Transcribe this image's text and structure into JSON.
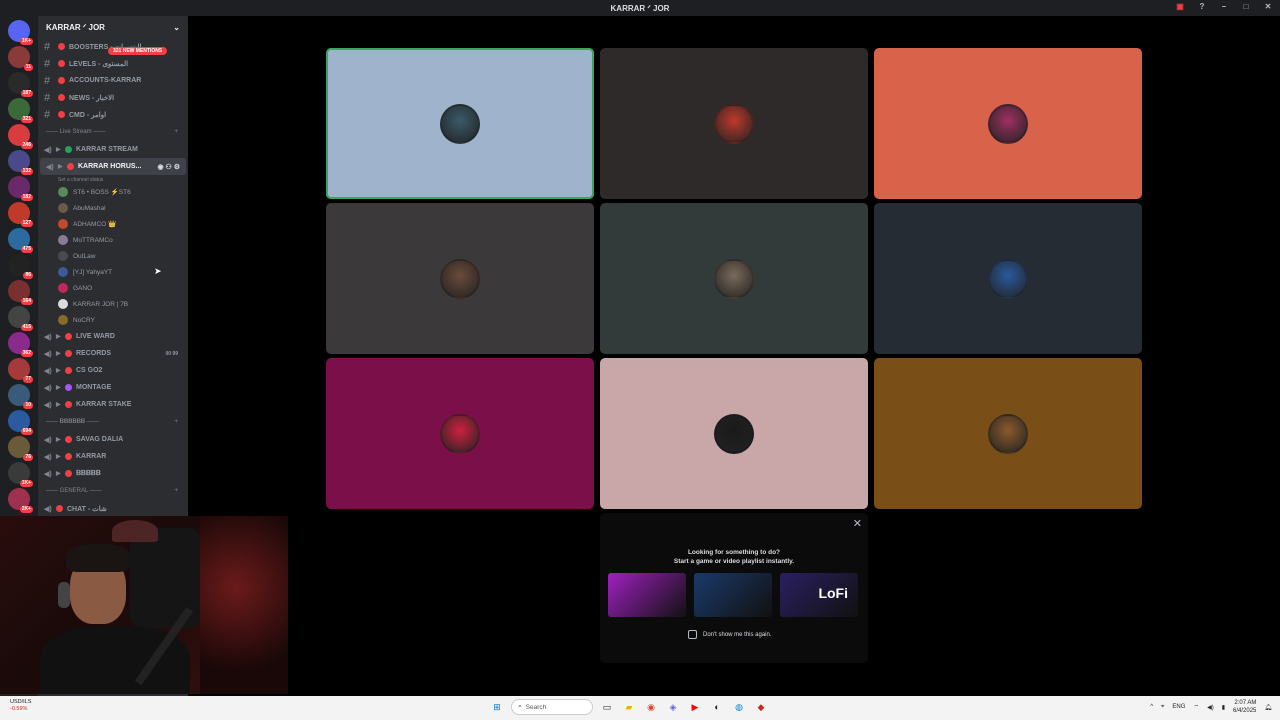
{
  "window": {
    "title": "KARRAR ᐟ JOR",
    "controls": [
      "inbox-icon",
      "help-icon",
      "minimize-icon",
      "maximize-icon",
      "close-icon"
    ]
  },
  "server_badges": [
    "1K+",
    "11",
    "187",
    "321",
    "246",
    "132",
    "182",
    "127",
    "475",
    "86",
    "164",
    "415",
    "362",
    "77",
    "10",
    "694",
    "76",
    "1K+",
    "2K+"
  ],
  "server_colors": [
    "#5865f2",
    "#8b3a3a",
    "#2a2a2a",
    "#3a6a3a",
    "#d83c3e",
    "#4a4a8a",
    "#6a2a6a",
    "#c0392b",
    "#2d6aa0",
    "#222",
    "#7a3030",
    "#444",
    "#8a2a8a",
    "#a63a3a",
    "#3a5a7a",
    "#2a5aa0",
    "#6a5a3a",
    "#3a3a3a",
    "#a03050"
  ],
  "guild": {
    "name": "KARRAR ᐟ JOR",
    "mention_pill": "321 NEW MENTIONS",
    "text_channels": [
      {
        "label": "BOOSTERS - البنسرات",
        "dot": "#f23f43"
      },
      {
        "label": "LEVELS - المستوى",
        "dot": "#f23f43"
      },
      {
        "label": "ACCOUNTS-KARRAR",
        "dot": "#f23f43"
      },
      {
        "label": "NEWS - الاخبار",
        "dot": "#f23f43"
      },
      {
        "label": "CMD - اوامر",
        "dot": "#f23f43"
      }
    ],
    "cat_live": "Live Stream",
    "voice_top": [
      {
        "label": "KARRAR STREAM",
        "dot": "#23a55a",
        "active": false
      },
      {
        "label": "KARRAR HORUS...",
        "dot": "#f23f43",
        "active": true
      }
    ],
    "channel_status": "Set a channel status",
    "voice_users": [
      {
        "name": "ST6 • BOSS ⚡ST6",
        "color": "#5a8a5a"
      },
      {
        "name": "AbuMashal",
        "color": "#6a5a4a"
      },
      {
        "name": "ADHAMCO 👑",
        "color": "#c04a2a"
      },
      {
        "name": "MoTTRAMCo",
        "color": "#8a7a9a"
      },
      {
        "name": "OutLaw",
        "color": "#4a4a4a"
      },
      {
        "name": "[YJ] YahyaYT",
        "color": "#3a5a9a"
      },
      {
        "name": "GANO",
        "color": "#c0285a"
      },
      {
        "name": "KARRAR JOR | 7B",
        "color": "#dddddd"
      },
      {
        "name": "NoCRY",
        "color": "#8a6a2a"
      }
    ],
    "voice_more": [
      {
        "label": "LIVE WARD",
        "dot": "#f23f43",
        "meta": ""
      },
      {
        "label": "RECORDS",
        "dot": "#f23f43",
        "meta": "00 99"
      },
      {
        "label": "CS GO2",
        "dot": "#f23f43",
        "meta": ""
      },
      {
        "label": "MONTAGE",
        "dot": "#a855f7",
        "meta": ""
      },
      {
        "label": "KARRAR STAKE",
        "dot": "#f23f43",
        "meta": ""
      }
    ],
    "cat_b": "𝐁𝐁𝐁𝐁𝐁𝐁",
    "voice_b": [
      {
        "label": "SAVAG DALIA",
        "dot": "#f23f43"
      },
      {
        "label": "KARRAR",
        "dot": "#f23f43"
      },
      {
        "label": "𝐁𝐁𝐁𝐁𝐁",
        "dot": "#f23f43"
      }
    ],
    "cat_general": "GENERAL",
    "chat_channel": "CHAT - شات"
  },
  "tiles": [
    {
      "bg": "#9fb4cc",
      "avatar": "#3a5a6a",
      "speaking": true
    },
    {
      "bg": "#2e2a2a",
      "avatar": "#c0392b",
      "speaking": false
    },
    {
      "bg": "#d9624a",
      "avatar": "#a03060",
      "speaking": false
    },
    {
      "bg": "#3b3939",
      "avatar": "#6a4a3a",
      "speaking": false
    },
    {
      "bg": "#333a3a",
      "avatar": "#7a6a5a",
      "speaking": false
    },
    {
      "bg": "#262c33",
      "avatar": "#2a5aa0",
      "speaking": false
    },
    {
      "bg": "#7a0f4a",
      "avatar": "#d02040",
      "speaking": false
    },
    {
      "bg": "#c9a6a8",
      "avatar": "#1a1a1a",
      "speaking": false
    },
    {
      "bg": "#7a4f17",
      "avatar": "#8a5a2a",
      "speaking": false
    }
  ],
  "activity": {
    "line1": "Looking for something to do?",
    "line2": "Start a game or video playlist instantly.",
    "cards": [
      {
        "name": "blocks-game",
        "text": "",
        "bg": "#a020c0"
      },
      {
        "name": "samurai-game",
        "text": "",
        "bg": "#1a3a6a"
      },
      {
        "name": "lofi-playlist",
        "text": "LoFi",
        "bg": "#2a2060"
      }
    ],
    "checkbox_label": "Don't show me this again."
  },
  "taskbar": {
    "ticker_name": "USD/ILS",
    "ticker_change": "-0.59%",
    "search_placeholder": "Search",
    "lang": "ENG",
    "time": "2:07 AM",
    "date": "6/4/2025"
  }
}
